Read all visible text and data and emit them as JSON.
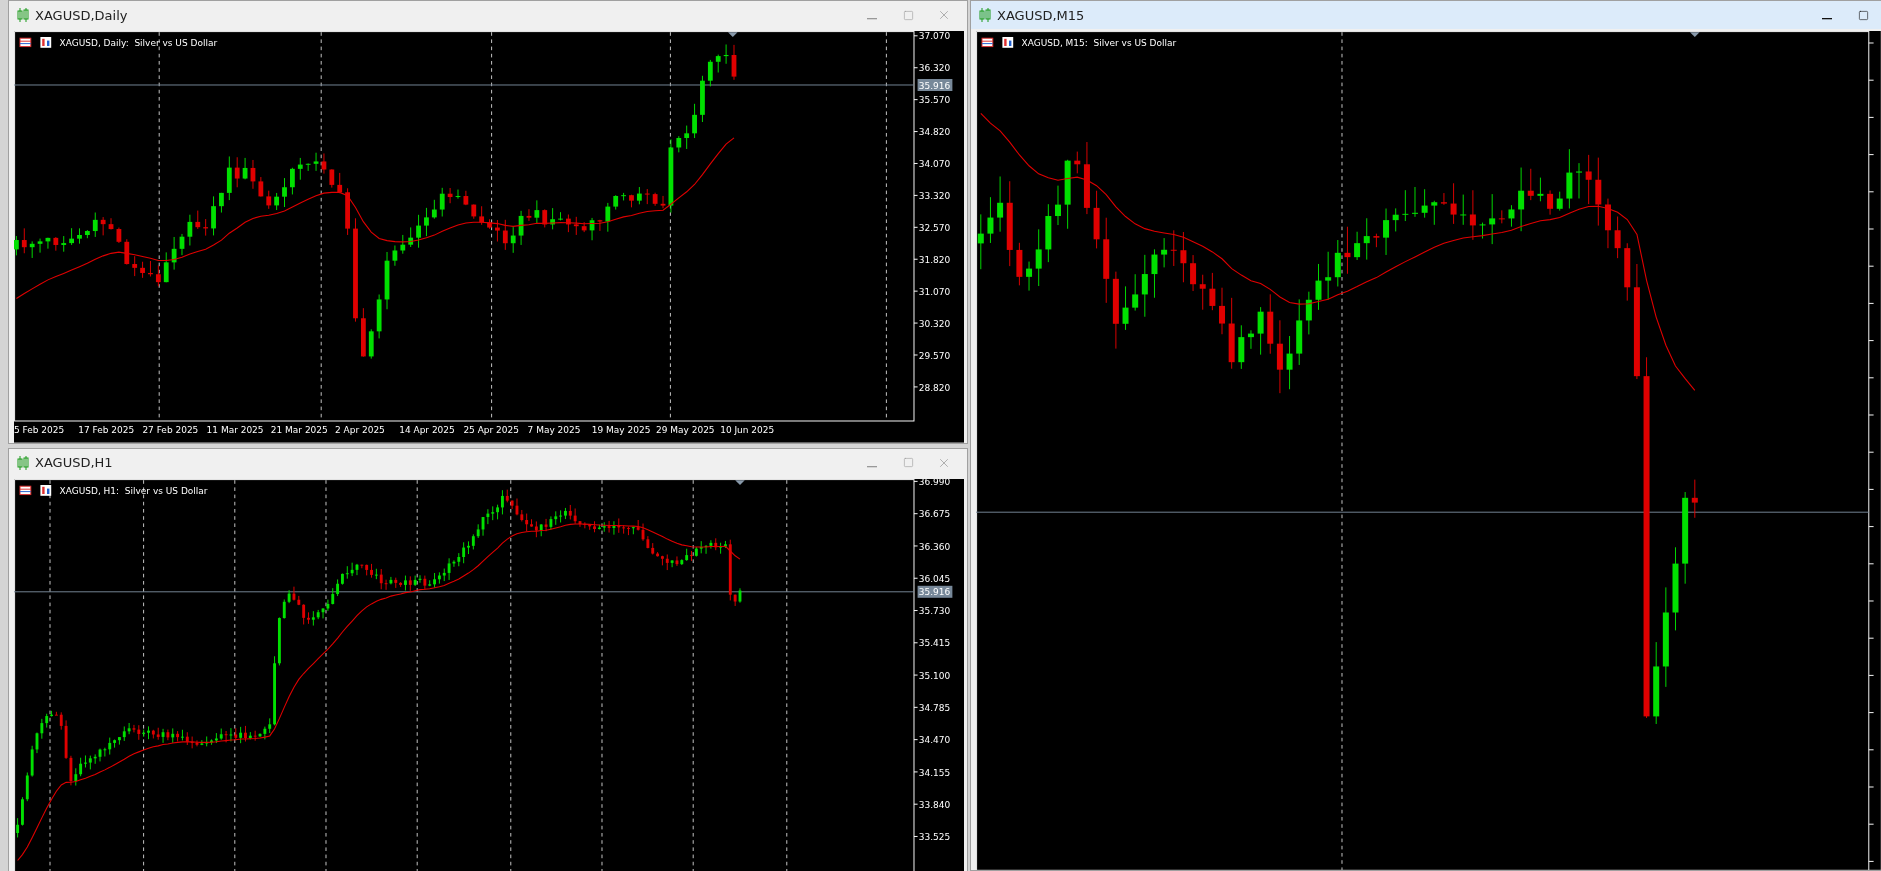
{
  "windows": [
    {
      "title": "XAGUSD,Daily",
      "active": false,
      "close_button": true,
      "chart_header": "XAGUSD, Daily:  Silver vs US Dollar",
      "price_labels": [
        "37.070",
        "36.320",
        "35.570",
        "34.820",
        "34.070",
        "33.320",
        "32.570",
        "31.820",
        "31.070",
        "30.320",
        "29.570",
        "28.820"
      ],
      "current_price": "35.916",
      "date_labels": [
        "5 Feb 2025",
        "17 Feb 2025",
        "27 Feb 2025",
        "11 Mar 2025",
        "21 Mar 2025",
        "2 Apr 2025",
        "14 Apr 2025",
        "25 Apr 2025",
        "7 May 2025",
        "19 May 2025",
        "29 May 2025",
        "10 Jun 2025"
      ]
    },
    {
      "title": "XAGUSD,H1",
      "active": false,
      "close_button": true,
      "chart_header": "XAGUSD, H1:  Silver vs US Dollar",
      "price_labels": [
        "36.990",
        "36.675",
        "36.360",
        "36.045",
        "35.730",
        "35.415",
        "35.100",
        "34.785",
        "34.470",
        "34.155",
        "33.840",
        "33.525"
      ],
      "current_price": "35.916"
    },
    {
      "title": "XAGUSD,M15",
      "active": true,
      "close_button": false,
      "chart_header": "XAGUSD, M15:  Silver vs US Dollar"
    }
  ]
}
